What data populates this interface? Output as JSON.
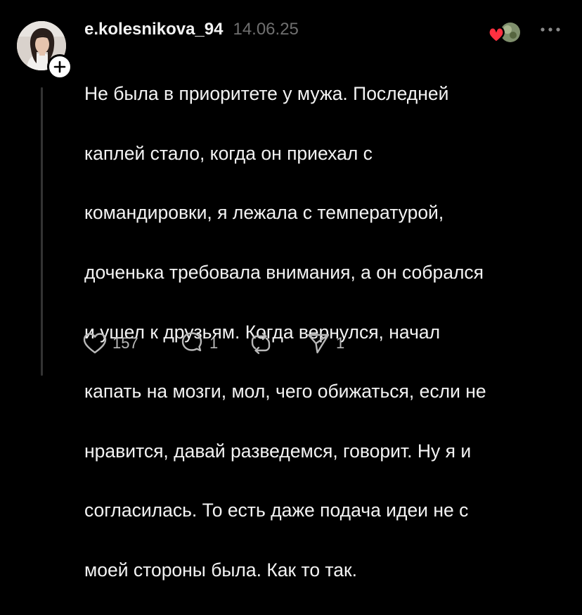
{
  "post": {
    "username": "e.kolesnikova_94",
    "timestamp": "14.06.25",
    "lines": [
      "Не была в приоритете у мужа. Последней",
      "каплей стало, когда он приехал с",
      "командировки, я лежала с температурой,",
      "доченька требовала внимания, а он собрался",
      "и ушел к друзьям. Когда вернулся, начал",
      "капать на мозги, мол, чего обижаться, если не",
      "нравится, давай разведемся, говорит. Ну я и",
      "согласилась. То есть даже подача идеи не с",
      "моей стороны была. Как то так."
    ],
    "actions": {
      "likes": "157",
      "replies": "1",
      "shares": "1"
    }
  },
  "icons": {
    "avatar": "user-photo",
    "follow": "plus-icon",
    "reaction": "heart-reaction-icon",
    "more": "more-dots-icon",
    "like": "heart-icon",
    "reply": "comment-icon",
    "repost": "repost-icon",
    "share": "send-icon"
  },
  "colors": {
    "background": "#000000",
    "text": "#f3f3f3",
    "muted": "#6f6f6f",
    "action": "#b8b8b8",
    "heart": "#ff3040"
  }
}
